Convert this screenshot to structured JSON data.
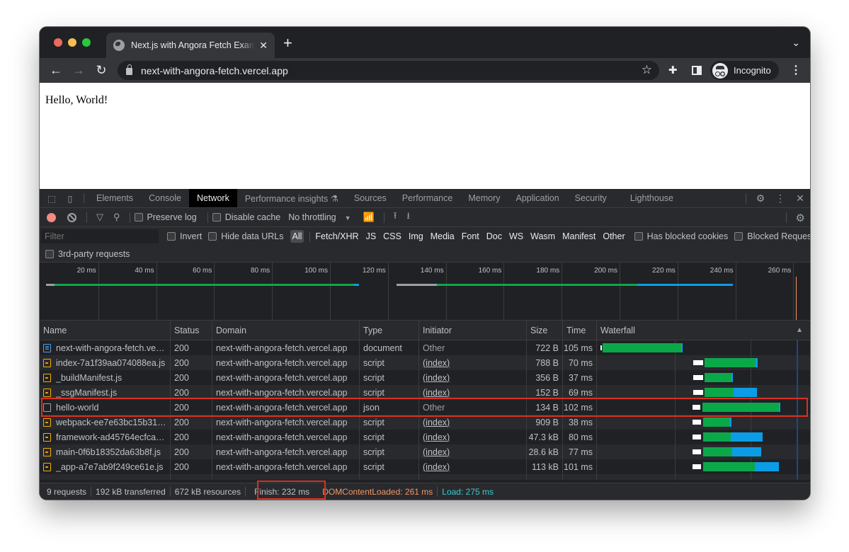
{
  "browser": {
    "tab_title": "Next.js with Angora Fetch Example",
    "url": "next-with-angora-fetch.vercel.app",
    "profile_label": "Incognito",
    "icons": {
      "back": "arrow-left-icon",
      "forward": "arrow-right-icon",
      "reload": "reload-icon",
      "lock": "lock-icon",
      "bookmark": "star-icon",
      "extensions": "puzzle-icon",
      "side_panel": "side-panel-icon",
      "menu": "kebab-icon",
      "new_tab": "plus-icon"
    }
  },
  "page": {
    "content": "Hello, World!"
  },
  "devtools": {
    "tabs": [
      "Elements",
      "Console",
      "Network",
      "Performance insights ⚗",
      "Sources",
      "Performance",
      "Memory",
      "Application",
      "Security",
      "Lighthouse"
    ],
    "active_tab": "Network",
    "toolbar": {
      "preserve_log": "Preserve log",
      "disable_cache": "Disable cache",
      "throttling": "No throttling"
    },
    "filter": {
      "placeholder": "Filter",
      "invert": "Invert",
      "hide_data_urls": "Hide data URLs",
      "types": [
        "All",
        "Fetch/XHR",
        "JS",
        "CSS",
        "Img",
        "Media",
        "Font",
        "Doc",
        "WS",
        "Wasm",
        "Manifest",
        "Other"
      ],
      "active_type": "All",
      "has_blocked_cookies": "Has blocked cookies",
      "blocked_requests": "Blocked Requests",
      "third_party": "3rd-party requests"
    },
    "overview": {
      "ticks": [
        "20 ms",
        "40 ms",
        "60 ms",
        "80 ms",
        "100 ms",
        "120 ms",
        "140 ms",
        "160 ms",
        "180 ms",
        "200 ms",
        "220 ms",
        "240 ms",
        "260 ms"
      ]
    },
    "table": {
      "columns": [
        "Name",
        "Status",
        "Domain",
        "Type",
        "Initiator",
        "Size",
        "Time",
        "Waterfall"
      ],
      "rows": [
        {
          "name": "next-with-angora-fetch.ve…",
          "icon": "doc",
          "status": "200",
          "domain": "next-with-angora-fetch.vercel.app",
          "type": "document",
          "initiator": "Other",
          "initiator_link": false,
          "size": "722 B",
          "time": "105 ms",
          "wf": {
            "start": 2,
            "wait": 3,
            "ttfb": 103,
            "download": 2
          }
        },
        {
          "name": "index-7a1f39aa074088ea.js",
          "icon": "js",
          "status": "200",
          "domain": "next-with-angora-fetch.vercel.app",
          "type": "script",
          "initiator": "(index)",
          "initiator_link": true,
          "size": "788 B",
          "time": "70 ms",
          "wf": {
            "start": 124,
            "wait": 15,
            "ttfb": 68,
            "download": 2
          }
        },
        {
          "name": "_buildManifest.js",
          "icon": "js",
          "status": "200",
          "domain": "next-with-angora-fetch.vercel.app",
          "type": "script",
          "initiator": "(index)",
          "initiator_link": true,
          "size": "356 B",
          "time": "37 ms",
          "wf": {
            "start": 124,
            "wait": 15,
            "ttfb": 36,
            "download": 2
          }
        },
        {
          "name": "_ssgManifest.js",
          "icon": "js",
          "status": "200",
          "domain": "next-with-angora-fetch.vercel.app",
          "type": "script",
          "initiator": "(index)",
          "initiator_link": true,
          "size": "152 B",
          "time": "69 ms",
          "wf": {
            "start": 124,
            "wait": 15,
            "ttfb": 39,
            "download": 30
          }
        },
        {
          "name": "hello-world",
          "icon": "json",
          "status": "200",
          "domain": "next-with-angora-fetch.vercel.app",
          "type": "json",
          "initiator": "Other",
          "initiator_link": false,
          "size": "134 B",
          "time": "102 ms",
          "wf": {
            "start": 123,
            "wait": 13,
            "ttfb": 101,
            "download": 2
          },
          "highlighted": true
        },
        {
          "name": "webpack-ee7e63bc15b31…",
          "icon": "js",
          "status": "200",
          "domain": "next-with-angora-fetch.vercel.app",
          "type": "script",
          "initiator": "(index)",
          "initiator_link": true,
          "size": "909 B",
          "time": "38 ms",
          "wf": {
            "start": 123,
            "wait": 14,
            "ttfb": 36,
            "download": 2
          }
        },
        {
          "name": "framework-ad45764ecfca…",
          "icon": "js",
          "status": "200",
          "domain": "next-with-angora-fetch.vercel.app",
          "type": "script",
          "initiator": "(index)",
          "initiator_link": true,
          "size": "47.3 kB",
          "time": "80 ms",
          "wf": {
            "start": 123,
            "wait": 14,
            "ttfb": 37,
            "download": 42
          }
        },
        {
          "name": "main-0f6b18352da63b8f.js",
          "icon": "js",
          "status": "200",
          "domain": "next-with-angora-fetch.vercel.app",
          "type": "script",
          "initiator": "(index)",
          "initiator_link": true,
          "size": "28.6 kB",
          "time": "77 ms",
          "wf": {
            "start": 123,
            "wait": 14,
            "ttfb": 39,
            "download": 38
          }
        },
        {
          "name": "_app-a7e7ab9f249ce61e.js",
          "icon": "js",
          "status": "200",
          "domain": "next-with-angora-fetch.vercel.app",
          "type": "script",
          "initiator": "(index)",
          "initiator_link": true,
          "size": "113 kB",
          "time": "101 ms",
          "wf": {
            "start": 123,
            "wait": 14,
            "ttfb": 69,
            "download": 31
          }
        }
      ]
    },
    "status_bar": {
      "requests": "9 requests",
      "transferred": "192 kB transferred",
      "resources": "672 kB resources",
      "finish": "Finish: 232 ms",
      "dom_content_loaded": "DOMContentLoaded: 261 ms",
      "load": "Load: 275 ms"
    },
    "colors": {
      "ttfb": "#0ba84a",
      "download": "#0a9de6",
      "waiting": "#ffffff",
      "dom_content_loaded": "#f29766",
      "load": "#3bcbd1",
      "highlight": "#d93025"
    }
  }
}
